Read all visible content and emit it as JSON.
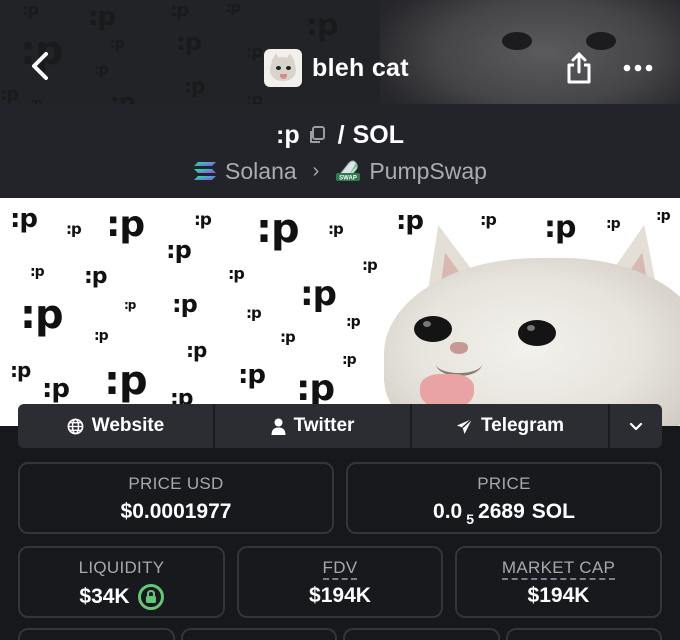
{
  "header": {
    "title": "bleh cat",
    "icons": {
      "back": "chevron-left-icon",
      "share": "share-icon",
      "more": "more-dots-icon",
      "avatar": "token-avatar"
    },
    "pattern_text": ":p"
  },
  "pair": {
    "base": ":p",
    "separator": "/",
    "quote": "SOL",
    "chain": "Solana",
    "dex": "PumpSwap",
    "dex_badge_text": "SWAP"
  },
  "banner": {
    "pattern_text": ":p"
  },
  "links": [
    {
      "label": "Website",
      "icon": "globe-icon"
    },
    {
      "label": "Twitter",
      "icon": "user-icon"
    },
    {
      "label": "Telegram",
      "icon": "send-icon"
    }
  ],
  "stats": {
    "price_usd": {
      "label": "PRICE USD",
      "value": "$0.0001977"
    },
    "price": {
      "label": "PRICE",
      "prefix": "0.0",
      "zeros": "5",
      "digits": "2689",
      "unit": "SOL"
    },
    "liquidity": {
      "label": "LIQUIDITY",
      "value": "$34K"
    },
    "fdv": {
      "label": "FDV",
      "value": "$194K"
    },
    "market_cap": {
      "label": "MARKET CAP",
      "value": "$194K"
    }
  },
  "colors": {
    "background": "#17181c",
    "card_border": "#34353b",
    "muted_text": "#a6a8b1",
    "lock_green": "#66c47b",
    "solana_purple": "#9945ff",
    "solana_green": "#14f195"
  }
}
